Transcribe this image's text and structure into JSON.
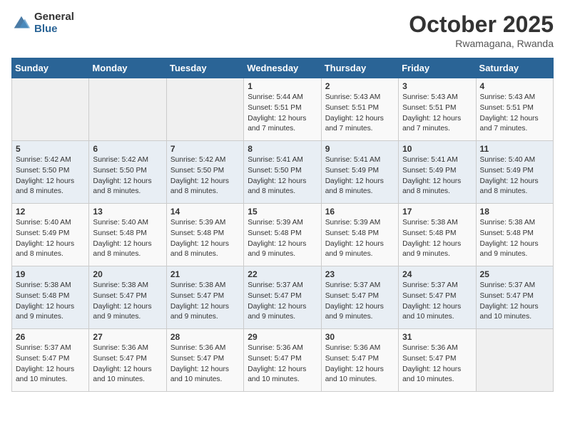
{
  "logo": {
    "general": "General",
    "blue": "Blue"
  },
  "title": {
    "month": "October 2025",
    "location": "Rwamagana, Rwanda"
  },
  "weekdays": [
    "Sunday",
    "Monday",
    "Tuesday",
    "Wednesday",
    "Thursday",
    "Friday",
    "Saturday"
  ],
  "weeks": [
    [
      {
        "day": "",
        "info": ""
      },
      {
        "day": "",
        "info": ""
      },
      {
        "day": "",
        "info": ""
      },
      {
        "day": "1",
        "info": "Sunrise: 5:44 AM\nSunset: 5:51 PM\nDaylight: 12 hours\nand 7 minutes."
      },
      {
        "day": "2",
        "info": "Sunrise: 5:43 AM\nSunset: 5:51 PM\nDaylight: 12 hours\nand 7 minutes."
      },
      {
        "day": "3",
        "info": "Sunrise: 5:43 AM\nSunset: 5:51 PM\nDaylight: 12 hours\nand 7 minutes."
      },
      {
        "day": "4",
        "info": "Sunrise: 5:43 AM\nSunset: 5:51 PM\nDaylight: 12 hours\nand 7 minutes."
      }
    ],
    [
      {
        "day": "5",
        "info": "Sunrise: 5:42 AM\nSunset: 5:50 PM\nDaylight: 12 hours\nand 8 minutes."
      },
      {
        "day": "6",
        "info": "Sunrise: 5:42 AM\nSunset: 5:50 PM\nDaylight: 12 hours\nand 8 minutes."
      },
      {
        "day": "7",
        "info": "Sunrise: 5:42 AM\nSunset: 5:50 PM\nDaylight: 12 hours\nand 8 minutes."
      },
      {
        "day": "8",
        "info": "Sunrise: 5:41 AM\nSunset: 5:50 PM\nDaylight: 12 hours\nand 8 minutes."
      },
      {
        "day": "9",
        "info": "Sunrise: 5:41 AM\nSunset: 5:49 PM\nDaylight: 12 hours\nand 8 minutes."
      },
      {
        "day": "10",
        "info": "Sunrise: 5:41 AM\nSunset: 5:49 PM\nDaylight: 12 hours\nand 8 minutes."
      },
      {
        "day": "11",
        "info": "Sunrise: 5:40 AM\nSunset: 5:49 PM\nDaylight: 12 hours\nand 8 minutes."
      }
    ],
    [
      {
        "day": "12",
        "info": "Sunrise: 5:40 AM\nSunset: 5:49 PM\nDaylight: 12 hours\nand 8 minutes."
      },
      {
        "day": "13",
        "info": "Sunrise: 5:40 AM\nSunset: 5:48 PM\nDaylight: 12 hours\nand 8 minutes."
      },
      {
        "day": "14",
        "info": "Sunrise: 5:39 AM\nSunset: 5:48 PM\nDaylight: 12 hours\nand 8 minutes."
      },
      {
        "day": "15",
        "info": "Sunrise: 5:39 AM\nSunset: 5:48 PM\nDaylight: 12 hours\nand 9 minutes."
      },
      {
        "day": "16",
        "info": "Sunrise: 5:39 AM\nSunset: 5:48 PM\nDaylight: 12 hours\nand 9 minutes."
      },
      {
        "day": "17",
        "info": "Sunrise: 5:38 AM\nSunset: 5:48 PM\nDaylight: 12 hours\nand 9 minutes."
      },
      {
        "day": "18",
        "info": "Sunrise: 5:38 AM\nSunset: 5:48 PM\nDaylight: 12 hours\nand 9 minutes."
      }
    ],
    [
      {
        "day": "19",
        "info": "Sunrise: 5:38 AM\nSunset: 5:48 PM\nDaylight: 12 hours\nand 9 minutes."
      },
      {
        "day": "20",
        "info": "Sunrise: 5:38 AM\nSunset: 5:47 PM\nDaylight: 12 hours\nand 9 minutes."
      },
      {
        "day": "21",
        "info": "Sunrise: 5:38 AM\nSunset: 5:47 PM\nDaylight: 12 hours\nand 9 minutes."
      },
      {
        "day": "22",
        "info": "Sunrise: 5:37 AM\nSunset: 5:47 PM\nDaylight: 12 hours\nand 9 minutes."
      },
      {
        "day": "23",
        "info": "Sunrise: 5:37 AM\nSunset: 5:47 PM\nDaylight: 12 hours\nand 9 minutes."
      },
      {
        "day": "24",
        "info": "Sunrise: 5:37 AM\nSunset: 5:47 PM\nDaylight: 12 hours\nand 10 minutes."
      },
      {
        "day": "25",
        "info": "Sunrise: 5:37 AM\nSunset: 5:47 PM\nDaylight: 12 hours\nand 10 minutes."
      }
    ],
    [
      {
        "day": "26",
        "info": "Sunrise: 5:37 AM\nSunset: 5:47 PM\nDaylight: 12 hours\nand 10 minutes."
      },
      {
        "day": "27",
        "info": "Sunrise: 5:36 AM\nSunset: 5:47 PM\nDaylight: 12 hours\nand 10 minutes."
      },
      {
        "day": "28",
        "info": "Sunrise: 5:36 AM\nSunset: 5:47 PM\nDaylight: 12 hours\nand 10 minutes."
      },
      {
        "day": "29",
        "info": "Sunrise: 5:36 AM\nSunset: 5:47 PM\nDaylight: 12 hours\nand 10 minutes."
      },
      {
        "day": "30",
        "info": "Sunrise: 5:36 AM\nSunset: 5:47 PM\nDaylight: 12 hours\nand 10 minutes."
      },
      {
        "day": "31",
        "info": "Sunrise: 5:36 AM\nSunset: 5:47 PM\nDaylight: 12 hours\nand 10 minutes."
      },
      {
        "day": "",
        "info": ""
      }
    ]
  ]
}
